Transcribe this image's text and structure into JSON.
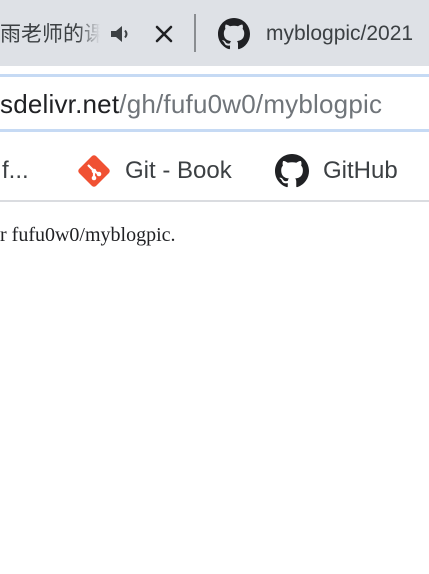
{
  "tabs": {
    "left_title": "雨老师的课",
    "right_title": "myblogpic/2021",
    "icons": [
      "audio-icon",
      "close-icon",
      "github-icon"
    ]
  },
  "omnibox": {
    "host": "sdelivr.net",
    "path": "/gh/fufu0w0/myblogpic"
  },
  "bookmarks": {
    "items": [
      {
        "label": "f...",
        "icon": ""
      },
      {
        "label": "Git - Book",
        "icon": "git-icon",
        "color": "#f05133"
      },
      {
        "label": "GitHub",
        "icon": "github-icon"
      }
    ]
  },
  "page": {
    "text": "r fufu0w0/myblogpic."
  }
}
